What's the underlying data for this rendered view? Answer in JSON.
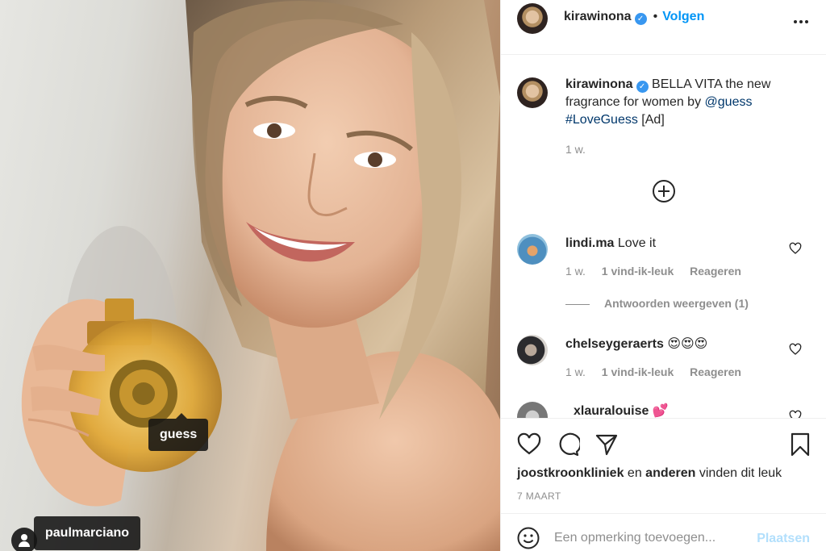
{
  "photo": {
    "tags": [
      {
        "label": "guess"
      },
      {
        "label": "paulmarciano"
      }
    ]
  },
  "header": {
    "username": "kirawinona",
    "verified_icon": "verified-badge-icon",
    "separator": "•",
    "follow_label": "Volgen",
    "more_icon": "more-horizontal-icon"
  },
  "caption": {
    "username": "kirawinona",
    "text": "BELLA VITA the new fragrance for women by",
    "mention": "@guess",
    "hashtag": "#LoveGuess",
    "suffix": "[Ad]",
    "time": "1 w."
  },
  "load_more_icon": "plus-circle-icon",
  "comments": [
    {
      "username": "lindi.ma",
      "text": "Love it",
      "time": "1 w.",
      "likes": "1 vind-ik-leuk",
      "reply": "Reageren",
      "view_replies": "Antwoorden weergeven (1)"
    },
    {
      "username": "chelseygeraerts",
      "text": "😍😍😍",
      "time": "1 w.",
      "likes": "1 vind-ik-leuk",
      "reply": "Reageren"
    },
    {
      "username": "xlauralouise",
      "text": "💕"
    }
  ],
  "actions": {
    "icons": [
      "heart-icon",
      "comment-icon",
      "share-icon",
      "bookmark-icon"
    ],
    "liked_by": "joostkroonkliniek",
    "liked_joiner": "en",
    "liked_others": "anderen",
    "liked_suffix": "vinden dit leuk",
    "date": "7 MAART"
  },
  "composer": {
    "placeholder": "Een opmerking toevoegen...",
    "submit_label": "Plaatsen"
  },
  "colors": {
    "accent": "#0095f6",
    "link": "#00376b",
    "muted": "#8e8e8e",
    "submit_disabled": "#b2dffc",
    "verified": "#3897f0"
  }
}
